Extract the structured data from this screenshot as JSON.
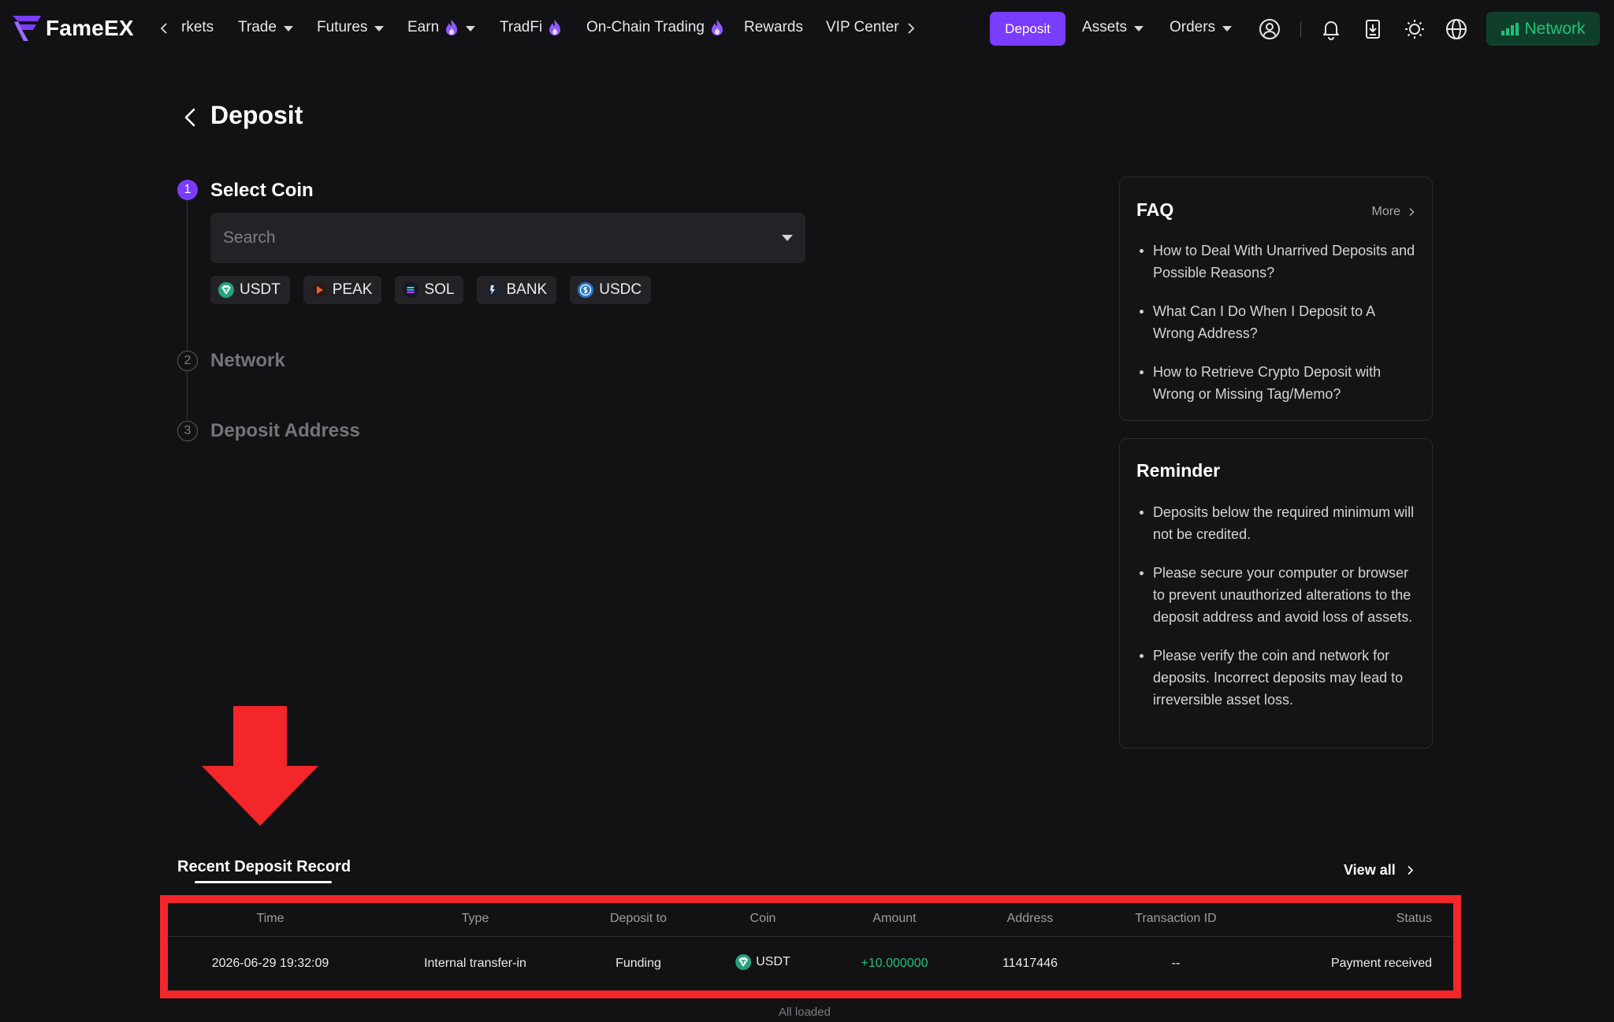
{
  "brand": {
    "name": "FameEX"
  },
  "nav": {
    "items": [
      {
        "label": "rkets"
      },
      {
        "label": "Trade"
      },
      {
        "label": "Futures"
      },
      {
        "label": "Earn"
      },
      {
        "label": "TradFi"
      },
      {
        "label": "On-Chain Trading"
      },
      {
        "label": "Rewards"
      },
      {
        "label": "VIP Center"
      }
    ],
    "deposit_label": "Deposit",
    "assets_label": "Assets",
    "orders_label": "Orders",
    "network_label": "Network"
  },
  "page": {
    "title": "Deposit"
  },
  "steps": [
    {
      "number": "1",
      "label": "Select Coin"
    },
    {
      "number": "2",
      "label": "Network"
    },
    {
      "number": "3",
      "label": "Deposit Address"
    }
  ],
  "search": {
    "placeholder": "Search"
  },
  "coins": [
    {
      "symbol": "USDT"
    },
    {
      "symbol": "PEAK"
    },
    {
      "symbol": "SOL"
    },
    {
      "symbol": "BANK"
    },
    {
      "symbol": "USDC"
    }
  ],
  "faq": {
    "title": "FAQ",
    "more_label": "More",
    "items": [
      "How to Deal With Unarrived Deposits and Possible Reasons?",
      "What Can I Do When I Deposit to A Wrong Address?",
      "How to Retrieve Crypto Deposit with Wrong or Missing Tag/Memo?"
    ]
  },
  "reminder": {
    "title": "Reminder",
    "items": [
      "Deposits below the required minimum will not be credited.",
      "Please secure your computer or browser to prevent unauthorized alterations to the deposit address and avoid loss of assets.",
      "Please verify the coin and network for deposits. Incorrect deposits may lead to irreversible asset loss."
    ]
  },
  "records": {
    "title": "Recent Deposit Record",
    "view_all_label": "View all",
    "columns": [
      "Time",
      "Type",
      "Deposit to",
      "Coin",
      "Amount",
      "Address",
      "Transaction ID",
      "Status"
    ],
    "rows": [
      {
        "time": "2026-06-29 19:32:09",
        "type": "Internal transfer-in",
        "deposit_to": "Funding",
        "coin": "USDT",
        "amount": "+10.000000",
        "address": "11417446",
        "transaction_id": "--",
        "status": "Payment received"
      }
    ],
    "footer": "All loaded"
  },
  "colors": {
    "accent": "#7a3cff",
    "positive": "#19c37d",
    "annotation": "#f3262a",
    "background": "#121214"
  },
  "icons": [
    "chevron-left-icon",
    "chevron-right-icon",
    "fire-icon",
    "user-icon",
    "bell-icon",
    "download-icon",
    "sun-icon",
    "globe-icon",
    "signal-icon",
    "back-arrow-icon",
    "dropdown-caret-icon",
    "usdt-icon",
    "peak-icon",
    "sol-icon",
    "bank-icon",
    "usdc-icon"
  ]
}
